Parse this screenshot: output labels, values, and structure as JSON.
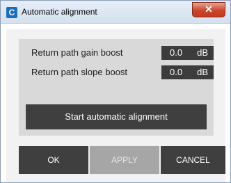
{
  "window": {
    "title": "Automatic alignment",
    "app_icon_letter": "C",
    "close_glyph": "✕"
  },
  "fields": [
    {
      "label": "Return path gain boost",
      "value": "0.0",
      "unit": "dB"
    },
    {
      "label": "Return path slope boost",
      "value": "0.0",
      "unit": "dB"
    }
  ],
  "actions": {
    "start_label": "Start automatic alignment",
    "ok_label": "OK",
    "apply_label": "APPLY",
    "cancel_label": "CANCEL"
  },
  "colors": {
    "dark_button": "#3f3f3f",
    "disabled_button": "#a6a6a6",
    "panel": "#d9d9d9",
    "close_red": "#c9472e"
  }
}
